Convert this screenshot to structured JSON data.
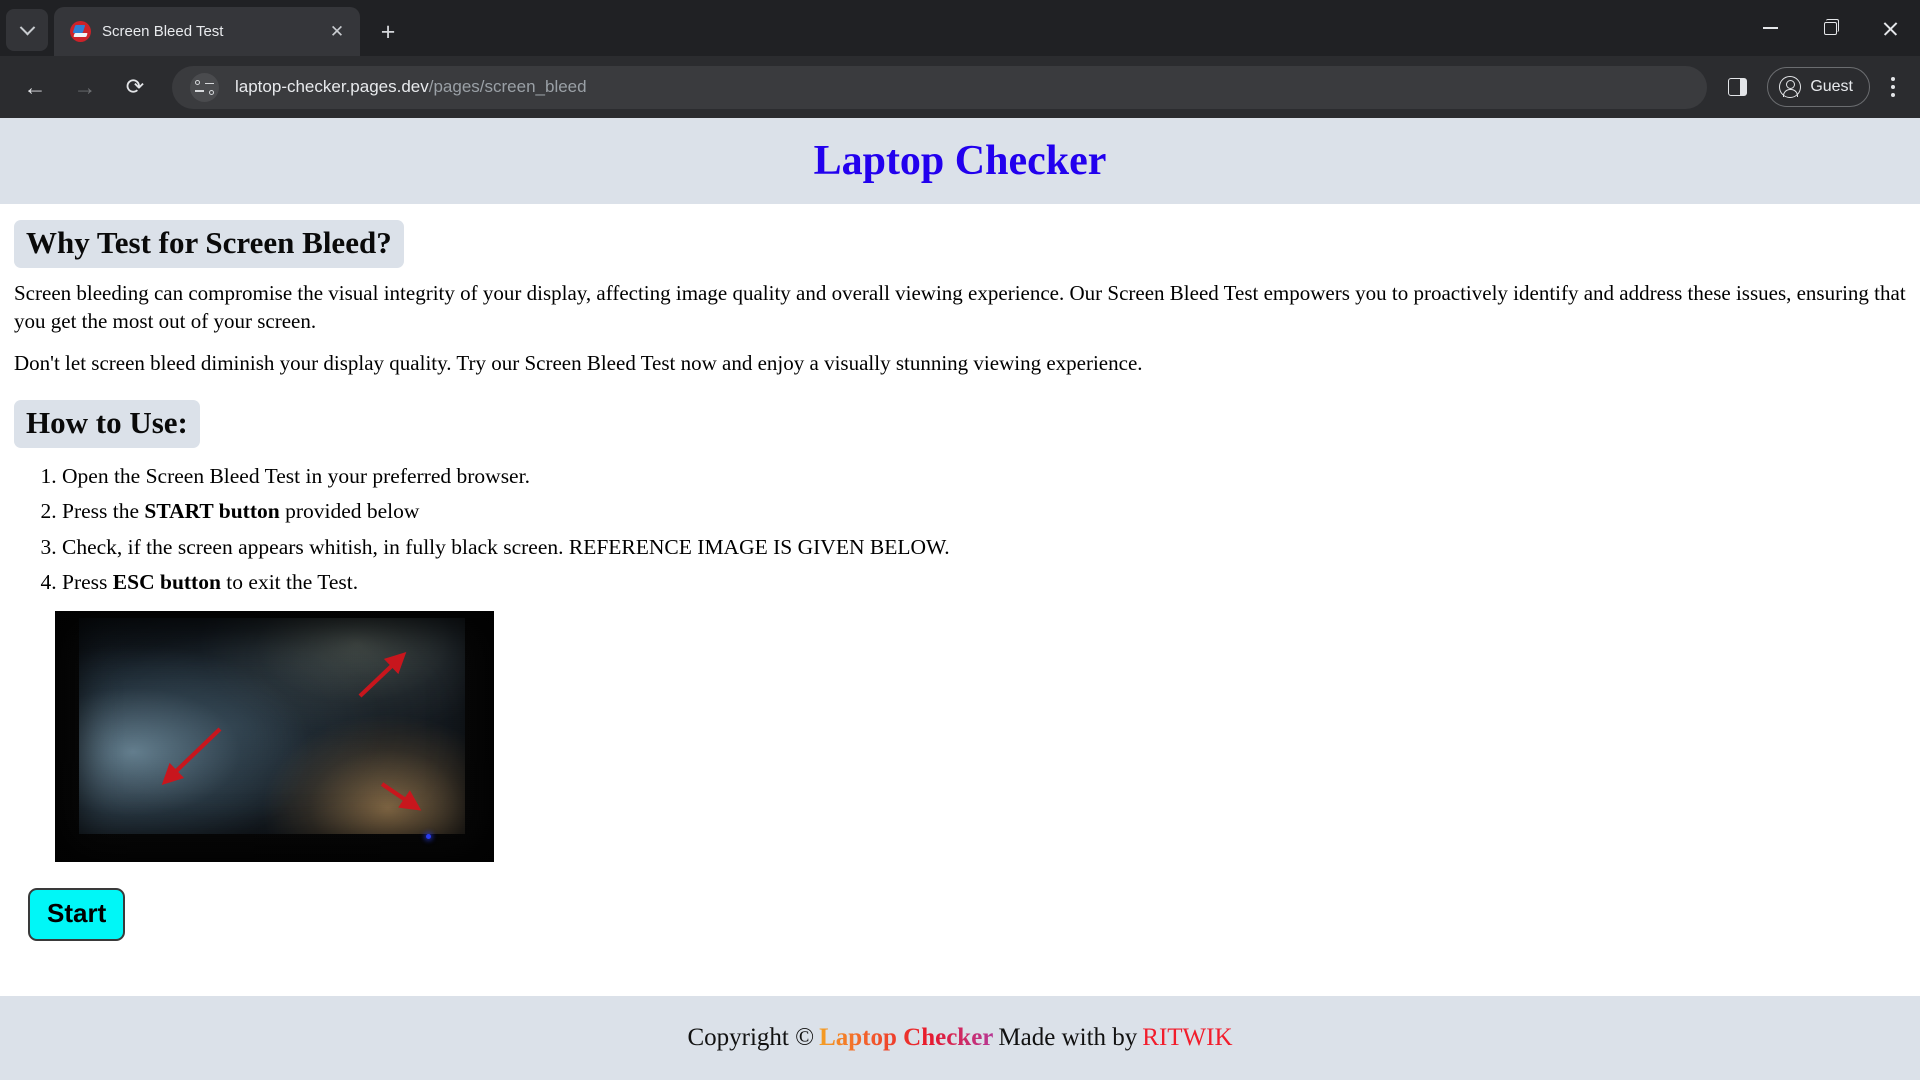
{
  "browser": {
    "tab_list_icon": "chevron-down-icon",
    "tab": {
      "title": "Screen Bleed Test",
      "favicon": "laptop-favicon",
      "close_label": "✕"
    },
    "new_tab_label": "+",
    "window_controls": {
      "minimize": "minimize-icon",
      "maximize": "maximize-icon",
      "close": "close-icon"
    },
    "toolbar": {
      "back": "←",
      "forward": "→",
      "reload": "⟳",
      "site_info_icon": "site-settings-icon",
      "url_domain": "laptop-checker.pages.dev",
      "url_path": "/pages/screen_bleed",
      "side_panel_icon": "side-panel-icon",
      "profile_label": "Guest",
      "menu_icon": "kebab-menu-icon"
    }
  },
  "page": {
    "title": "Laptop Checker",
    "title_color": "#2200ee",
    "band_color": "#dbe1e9",
    "sections": {
      "why": {
        "heading": "Why Test for Screen Bleed?",
        "paragraph_1": "Screen bleeding can compromise the visual integrity of your display, affecting image quality and overall viewing experience. Our Screen Bleed Test empowers you to proactively identify and address these issues, ensuring that you get the most out of your screen.",
        "paragraph_2": "Don't let screen bleed diminish your display quality. Try our Screen Bleed Test now and enjoy a visually stunning viewing experience."
      },
      "how": {
        "heading": "How to Use:",
        "steps": [
          {
            "pre": "Open the Screen Bleed Test in your preferred browser.",
            "bold": "",
            "post": ""
          },
          {
            "pre": "Press the ",
            "bold": "START button",
            "post": " provided below"
          },
          {
            "pre": "Check, if the screen appears whitish, in fully black screen. REFERENCE IMAGE IS GIVEN BELOW.",
            "bold": "",
            "post": ""
          },
          {
            "pre": "Press ",
            "bold": "ESC button",
            "post": " to exit the Test."
          }
        ]
      }
    },
    "reference_image": {
      "name": "screen-bleed-reference-photo",
      "description": "Photo of a dark laptop screen showing bluish backlight bleed at left and warm amber bleed at bottom right, annotated with three red arrows",
      "arrow_color": "#c8161d",
      "led_color": "#2a3cf0"
    },
    "start_button": {
      "label": "Start",
      "background": "#00f7f7",
      "border": "#3a3a3a"
    },
    "footer": {
      "copyright": "Copyright ©",
      "brand": "Laptop Checker",
      "made_with": "Made with by",
      "author": "RITWIK",
      "author_color": "#f21d2c"
    }
  }
}
